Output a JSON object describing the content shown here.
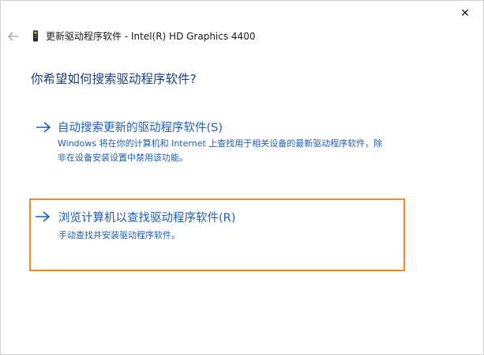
{
  "window": {
    "close_glyph": "✕"
  },
  "header": {
    "back_icon": "back-arrow-icon",
    "device_icon": "graphics-device-icon",
    "title": "更新驱动程序软件 - Intel(R) HD Graphics 4400"
  },
  "main": {
    "question": "你希望如何搜索驱动程序软件?",
    "options": [
      {
        "title": "自动搜索更新的驱动程序软件(S)",
        "description": "Windows 将在你的计算机和 Internet 上查找用于相关设备的最新驱动程序软件，除非在设备安装设置中禁用该功能。"
      },
      {
        "title": "浏览计算机以查找驱动程序软件(R)",
        "description": "手动查找并安装驱动程序软件。"
      }
    ]
  },
  "colors": {
    "link_blue": "#1f5db5",
    "heading_blue": "#1f3f7a",
    "highlight_orange": "#f08a24"
  }
}
